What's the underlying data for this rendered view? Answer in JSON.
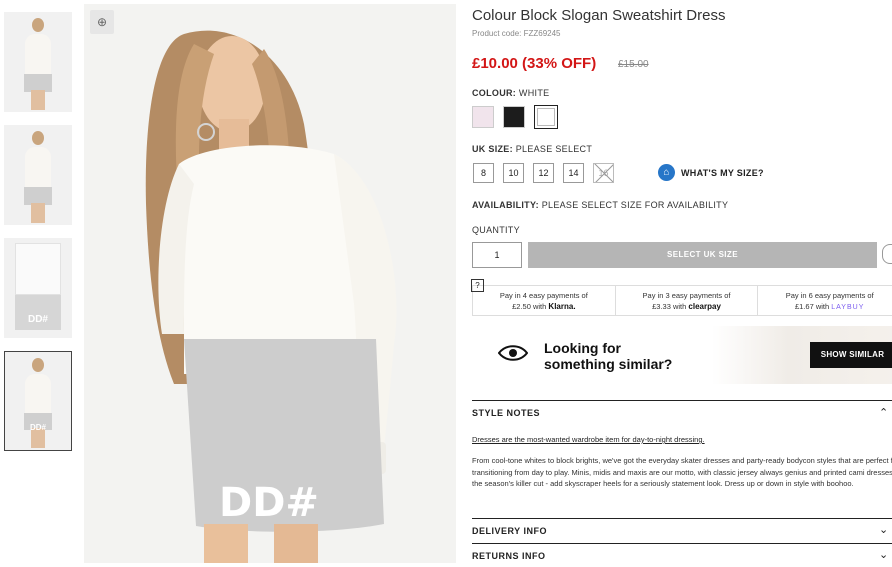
{
  "thumbnails": [
    {
      "label": "thumbnail-1"
    },
    {
      "label": "thumbnail-2"
    },
    {
      "label": "thumbnail-3",
      "print": "DD#"
    },
    {
      "label": "thumbnail-4",
      "print": "DD#"
    }
  ],
  "main_image": {
    "print": "DD#"
  },
  "product": {
    "title": "Colour Block Slogan Sweatshirt Dress",
    "code": "Product code: FZZ69245",
    "price": "£10.00 (33% OFF)",
    "old_price": "£15.00"
  },
  "colour": {
    "label": "COLOUR:",
    "value": "WHITE",
    "swatches": [
      {
        "name": "pink",
        "color": "#f1e4ec"
      },
      {
        "name": "black",
        "color": "#1c1c1c"
      },
      {
        "name": "white",
        "color": "#ffffff",
        "selected": true
      }
    ]
  },
  "size": {
    "label": "UK SIZE:",
    "value": "PLEASE SELECT",
    "options": [
      {
        "label": "8",
        "available": true
      },
      {
        "label": "10",
        "available": true
      },
      {
        "label": "12",
        "available": true
      },
      {
        "label": "14",
        "available": true
      },
      {
        "label": "16",
        "available": false
      }
    ],
    "whats_my_size": "WHAT'S MY SIZE?"
  },
  "availability": {
    "label": "AVAILABILITY:",
    "value": "PLEASE SELECT SIZE FOR AVAILABILITY"
  },
  "quantity": {
    "label": "QUANTITY",
    "value": "1"
  },
  "add_button": "SELECT UK SIZE",
  "payments": [
    {
      "line1": "Pay in 4 easy payments of",
      "amount": "£2.50 with",
      "brand": "Klarna."
    },
    {
      "line1": "Pay in 3 easy payments of",
      "amount": "£3.33 with",
      "brand": "clearpay"
    },
    {
      "line1": "Pay in 6 easy payments of",
      "amount": "£1.67 with",
      "brand": "LAYBUY"
    }
  ],
  "similar": {
    "line1": "Looking for",
    "line2": "something similar?",
    "button": "SHOW SIMILAR"
  },
  "style_notes": {
    "heading": "STYLE NOTES",
    "lead": "Dresses are the most-wanted wardrobe item for day-to-night dressing.",
    "body": "From cool-tone whites to block brights, we've got the everyday skater dresses and party-ready bodycon styles that are perfect for transitioning from day to play. Minis, midis and maxis are our motto, with classic jersey always genius and printed cami dresses the season's killer cut - add skyscraper heels for a seriously statement look. Dress up or down in style with boohoo."
  },
  "delivery": {
    "heading": "DELIVERY INFO"
  },
  "returns": {
    "heading": "RETURNS INFO"
  }
}
